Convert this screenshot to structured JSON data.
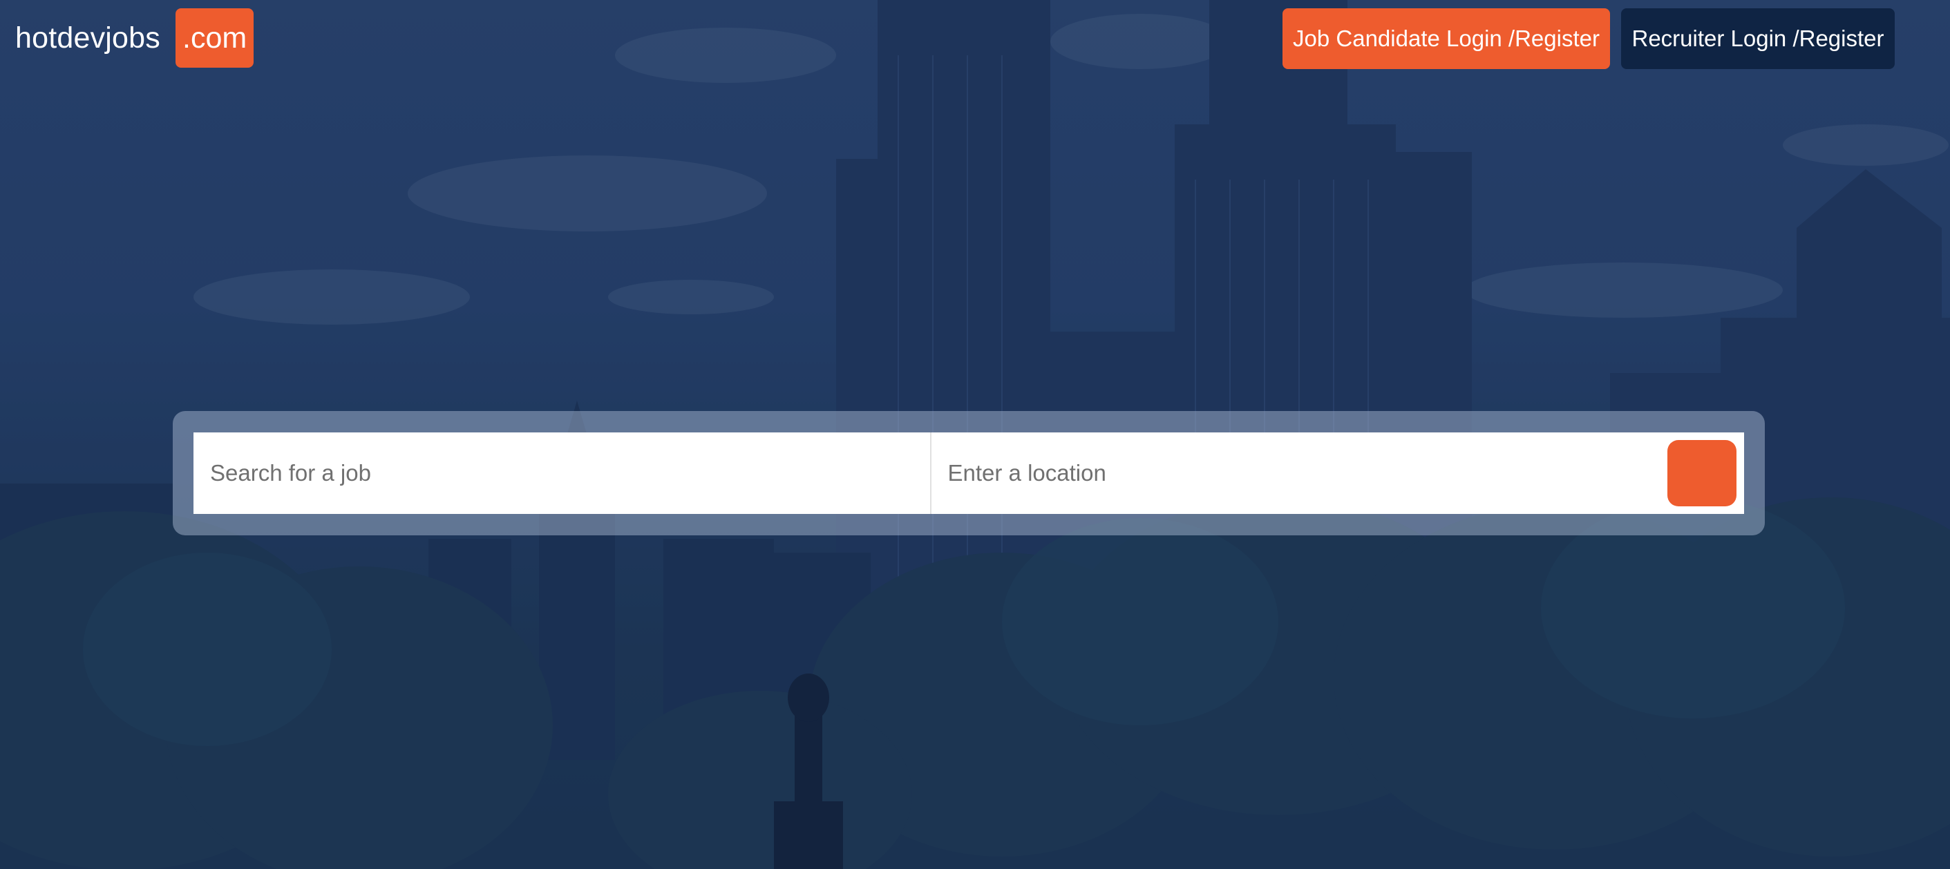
{
  "header": {
    "logo_text": "hotdevjobs",
    "logo_badge": ".com",
    "candidate_button": "Job Candidate Login /Register",
    "recruiter_button": "Recruiter Login /Register"
  },
  "search": {
    "job_placeholder": "Search for a job",
    "job_value": "",
    "location_placeholder": "Enter a location",
    "location_value": ""
  },
  "colors": {
    "accent": "#ee5c2e",
    "dark": "#0f2444",
    "overlay": "#2a4670"
  }
}
